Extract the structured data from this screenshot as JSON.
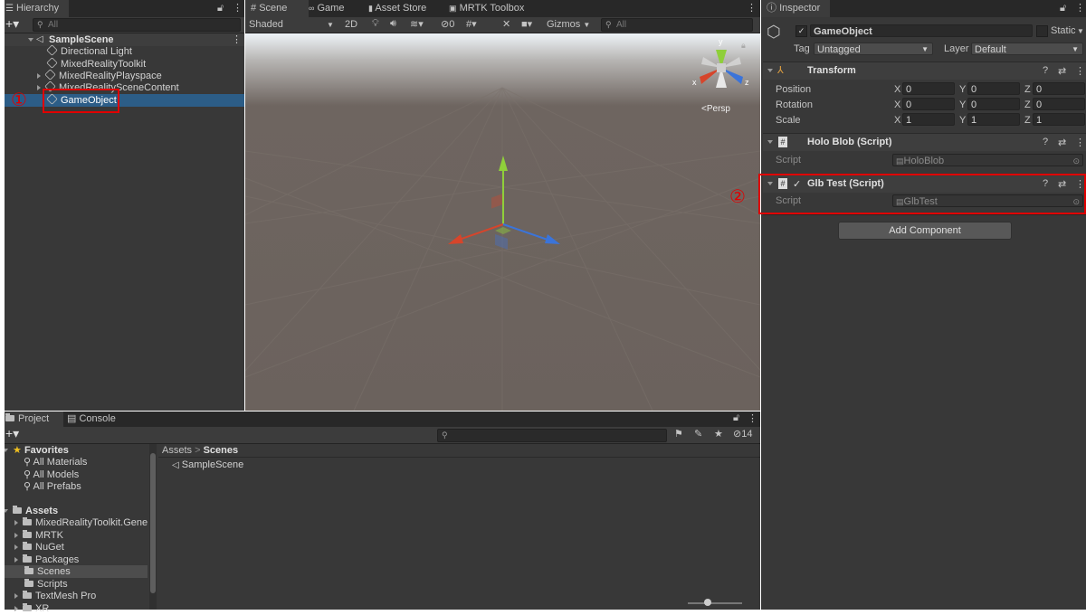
{
  "hierarchy": {
    "tab_label": "Hierarchy",
    "search_placeholder": "All",
    "scene_name": "SampleScene",
    "items": [
      {
        "label": "Directional Light"
      },
      {
        "label": "MixedRealityToolkit"
      },
      {
        "label": "MixedRealityPlayspace"
      },
      {
        "label": "MixedRealitySceneContent"
      },
      {
        "label": "GameObject"
      }
    ]
  },
  "scene": {
    "tabs": [
      {
        "label": "Scene"
      },
      {
        "label": "Game"
      },
      {
        "label": "Asset Store"
      },
      {
        "label": "MRTK Toolbox"
      }
    ],
    "shading_mode": "Shaded",
    "toggle_2d": "2D",
    "hidden_count": "0",
    "gizmos_label": "Gizmos",
    "search_placeholder": "All",
    "persp_label": "Persp",
    "axis_x": "x",
    "axis_y": "y",
    "axis_z": "z"
  },
  "inspector": {
    "tab_label": "Inspector",
    "object_name": "GameObject",
    "static_label": "Static",
    "tag_label": "Tag",
    "tag_value": "Untagged",
    "layer_label": "Layer",
    "layer_value": "Default",
    "transform": {
      "title": "Transform",
      "rows": [
        {
          "label": "Position",
          "x": "0",
          "y": "0",
          "z": "0"
        },
        {
          "label": "Rotation",
          "x": "0",
          "y": "0",
          "z": "0"
        },
        {
          "label": "Scale",
          "x": "1",
          "y": "1",
          "z": "1"
        }
      ],
      "x_label": "X",
      "y_label": "Y",
      "z_label": "Z"
    },
    "holo_blob": {
      "title": "Holo Blob (Script)",
      "script_label": "Script",
      "script_value": "HoloBlob"
    },
    "glb_test": {
      "title": "Glb Test (Script)",
      "script_label": "Script",
      "script_value": "GlbTest"
    },
    "add_component": "Add Component"
  },
  "project": {
    "tabs": [
      {
        "label": "Project"
      },
      {
        "label": "Console"
      }
    ],
    "hidden_count": "14",
    "favorites_label": "Favorites",
    "favorites": [
      {
        "label": "All Materials"
      },
      {
        "label": "All Models"
      },
      {
        "label": "All Prefabs"
      }
    ],
    "assets_label": "Assets",
    "folders": [
      {
        "label": "MixedRealityToolkit.Gene"
      },
      {
        "label": "MRTK"
      },
      {
        "label": "NuGet"
      },
      {
        "label": "Packages"
      },
      {
        "label": "Scenes"
      },
      {
        "label": "Scripts"
      },
      {
        "label": "TextMesh Pro"
      },
      {
        "label": "XR"
      }
    ],
    "breadcrumb_root": "Assets",
    "breadcrumb_sep": ">",
    "breadcrumb_current": "Scenes",
    "content_items": [
      {
        "label": "SampleScene"
      }
    ]
  },
  "annotations": {
    "one": "①",
    "two": "②"
  },
  "colors": {
    "accent_red": "#e00000",
    "selection_blue": "#2c5d87"
  }
}
